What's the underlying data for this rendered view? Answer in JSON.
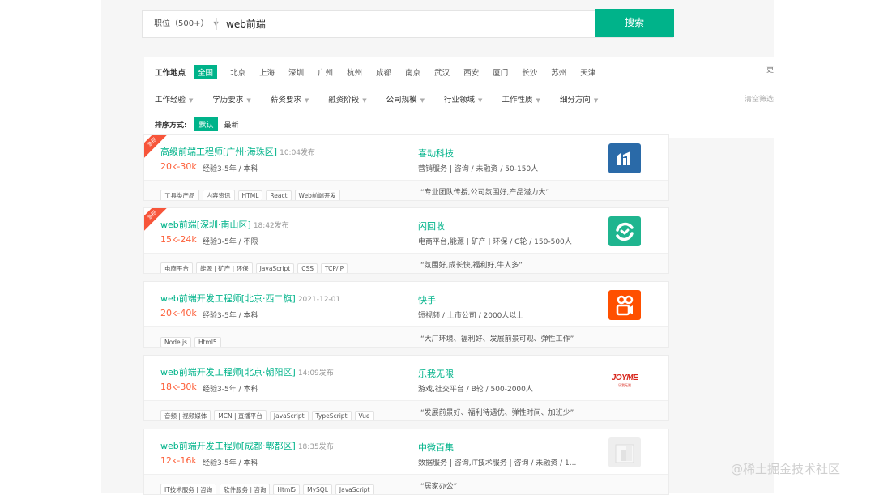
{
  "search": {
    "type_label": "职位（500+）",
    "query": "web前端",
    "button_label": "搜索"
  },
  "filters": {
    "city_label": "工作地点",
    "cities": [
      "全国",
      "北京",
      "上海",
      "深圳",
      "广州",
      "杭州",
      "成都",
      "南京",
      "武汉",
      "西安",
      "厦门",
      "长沙",
      "苏州",
      "天津"
    ],
    "active_city": "全国",
    "dropdowns": [
      "工作经验",
      "学历要求",
      "薪资要求",
      "融资阶段",
      "公司规模",
      "行业领域",
      "工作性质",
      "细分方向"
    ],
    "clear_label": "清空筛选",
    "side_char": "更"
  },
  "sort": {
    "label": "排序方式:",
    "options": [
      "默认",
      "最新"
    ],
    "active": "默认"
  },
  "jobs": [
    {
      "urgent": "急招",
      "title": "高级前端工程师[广州·海珠区]",
      "time": "10:04发布",
      "salary": "20k-30k",
      "requirements": "经验3-5年 / 本科",
      "company": "喜动科技",
      "company_info": "营销服务 | 咨询 / 未融资 / 50-150人",
      "tags": [
        "工具类产品",
        "内容资讯",
        "HTML",
        "React",
        "Web前端开发"
      ],
      "quote": "“专业团队传授,公司氛围好,产品潜力大”",
      "logo": {
        "type": "blue",
        "bg": "#2a6aa8"
      }
    },
    {
      "urgent": "急招",
      "title": "web前端[深圳·南山区]",
      "time": "18:42发布",
      "salary": "15k-24k",
      "requirements": "经验3-5年 / 不限",
      "company": "闪回收",
      "company_info": "电商平台,能源 | 矿产 | 环保 / C轮 / 150-500人",
      "tags": [
        "电商平台",
        "能源 | 矿产 | 环保",
        "JavaScript",
        "CSS",
        "TCP/IP"
      ],
      "quote": "“氛围好,成长快,福利好,牛人多”",
      "logo": {
        "type": "green",
        "bg": "#1fb58f"
      }
    },
    {
      "urgent": "",
      "title": "web前端开发工程师[北京·西二旗]",
      "time": "2021-12-01",
      "salary": "20k-40k",
      "requirements": "经验3-5年 / 本科",
      "company": "快手",
      "company_info": "短视频 / 上市公司 / 2000人以上",
      "tags": [
        "Node.js",
        "Html5"
      ],
      "quote": "“大厂环境、福利好、发展前景可观、弹性工作”",
      "logo": {
        "type": "orange",
        "bg": "#ff5000"
      }
    },
    {
      "urgent": "",
      "title": "web前端开发工程师[北京·朝阳区]",
      "time": "14:09发布",
      "salary": "18k-30k",
      "requirements": "经验3-5年 / 本科",
      "company": "乐我无限",
      "company_info": "游戏,社交平台 / B轮 / 500-2000人",
      "tags": [
        "音频 | 视频媒体",
        "MCN | 直播平台",
        "JavaScript",
        "TypeScript",
        "Vue"
      ],
      "quote": "“发展前景好、福利待遇优、弹性时间、加班少”",
      "logo": {
        "type": "joyme",
        "text": "JOYME",
        "sub": "乐我无限"
      }
    },
    {
      "urgent": "",
      "title": "web前端开发工程师[成都·郫都区]",
      "time": "18:35发布",
      "salary": "12k-16k",
      "requirements": "经验3-5年 / 本科",
      "company": "中微百集",
      "company_info": "数据服务 | 咨询,IT技术服务 | 咨询 / 未融资 / 1...",
      "tags": [
        "IT技术服务 | 咨询",
        "软件服务 | 咨询",
        "Html5",
        "MySQL",
        "JavaScript"
      ],
      "quote": "“居家办公”",
      "logo": {
        "type": "grey",
        "bg": "#eeeeee"
      }
    }
  ],
  "watermark": "@稀土掘金技术社区"
}
